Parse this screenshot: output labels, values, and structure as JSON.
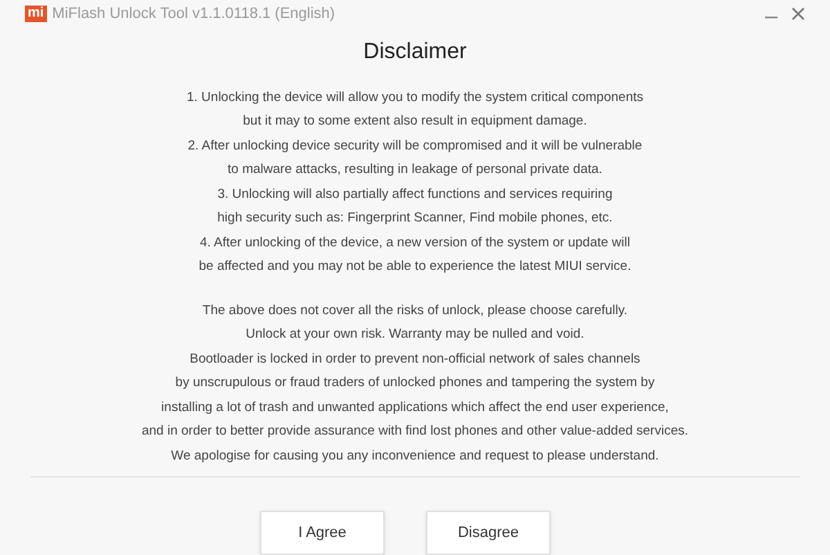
{
  "window": {
    "title": "MiFlash Unlock Tool v1.1.0118.1 (English)",
    "logo": "mi"
  },
  "heading": "Disclaimer",
  "paragraphs": [
    [
      "1. Unlocking the device will allow you to modify the system critical components",
      "but it may to some extent also result in equipment damage.",
      "2. After unlocking device security will be compromised and it will be vulnerable",
      "to malware attacks, resulting in leakage of personal private data.",
      "3. Unlocking will also partially affect functions and services requiring",
      "high security such as: Fingerprint Scanner, Find mobile phones, etc.",
      "4. After unlocking of the device, a new version of the system or update will",
      "be affected and you may not be able to experience the latest MIUI service."
    ],
    [
      "The above does not cover all the risks of unlock, please choose carefully.",
      "Unlock at your own risk. Warranty may be nulled and void.",
      "Bootloader is locked in order to prevent non-official network of sales channels",
      "by unscrupulous or fraud traders of unlocked phones and tampering the system by",
      "installing a lot of trash and unwanted applications which affect the end user experience,",
      "and in order to better provide assurance with find lost phones and other value-added services.",
      "We apologise for causing you any inconvenience and request to please understand."
    ]
  ],
  "buttons": [
    "I Agree",
    "Disagree"
  ]
}
